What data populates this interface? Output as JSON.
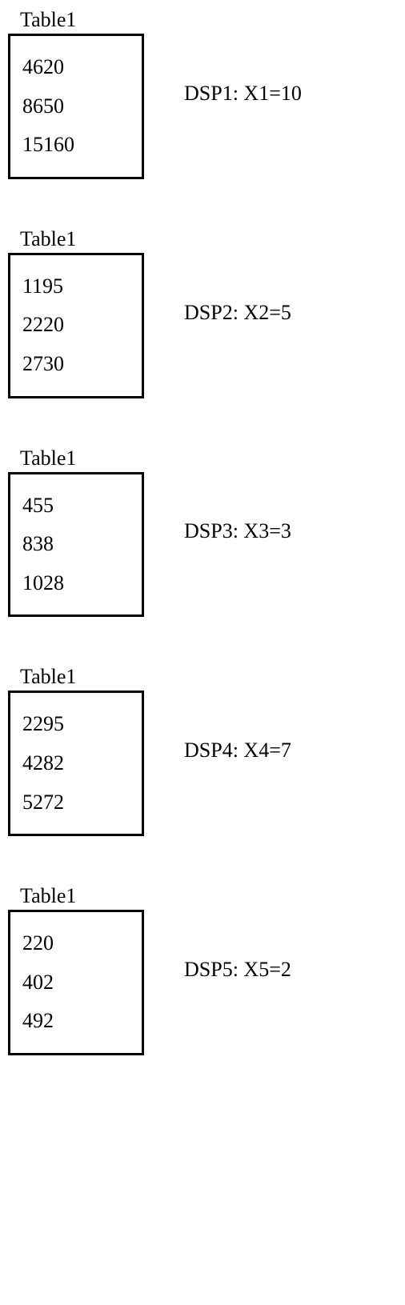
{
  "blocks": [
    {
      "title": "Table1",
      "values": [
        "4620",
        "8650",
        "15160"
      ],
      "label": "DSP1: X1=10"
    },
    {
      "title": "Table1",
      "values": [
        "1195",
        "2220",
        "2730"
      ],
      "label": "DSP2: X2=5"
    },
    {
      "title": "Table1",
      "values": [
        "455",
        "838",
        "1028"
      ],
      "label": "DSP3: X3=3"
    },
    {
      "title": "Table1",
      "values": [
        "2295",
        "4282",
        "5272"
      ],
      "label": "DSP4: X4=7"
    },
    {
      "title": "Table1",
      "values": [
        "220",
        "402",
        "492"
      ],
      "label": "DSP5: X5=2"
    }
  ]
}
